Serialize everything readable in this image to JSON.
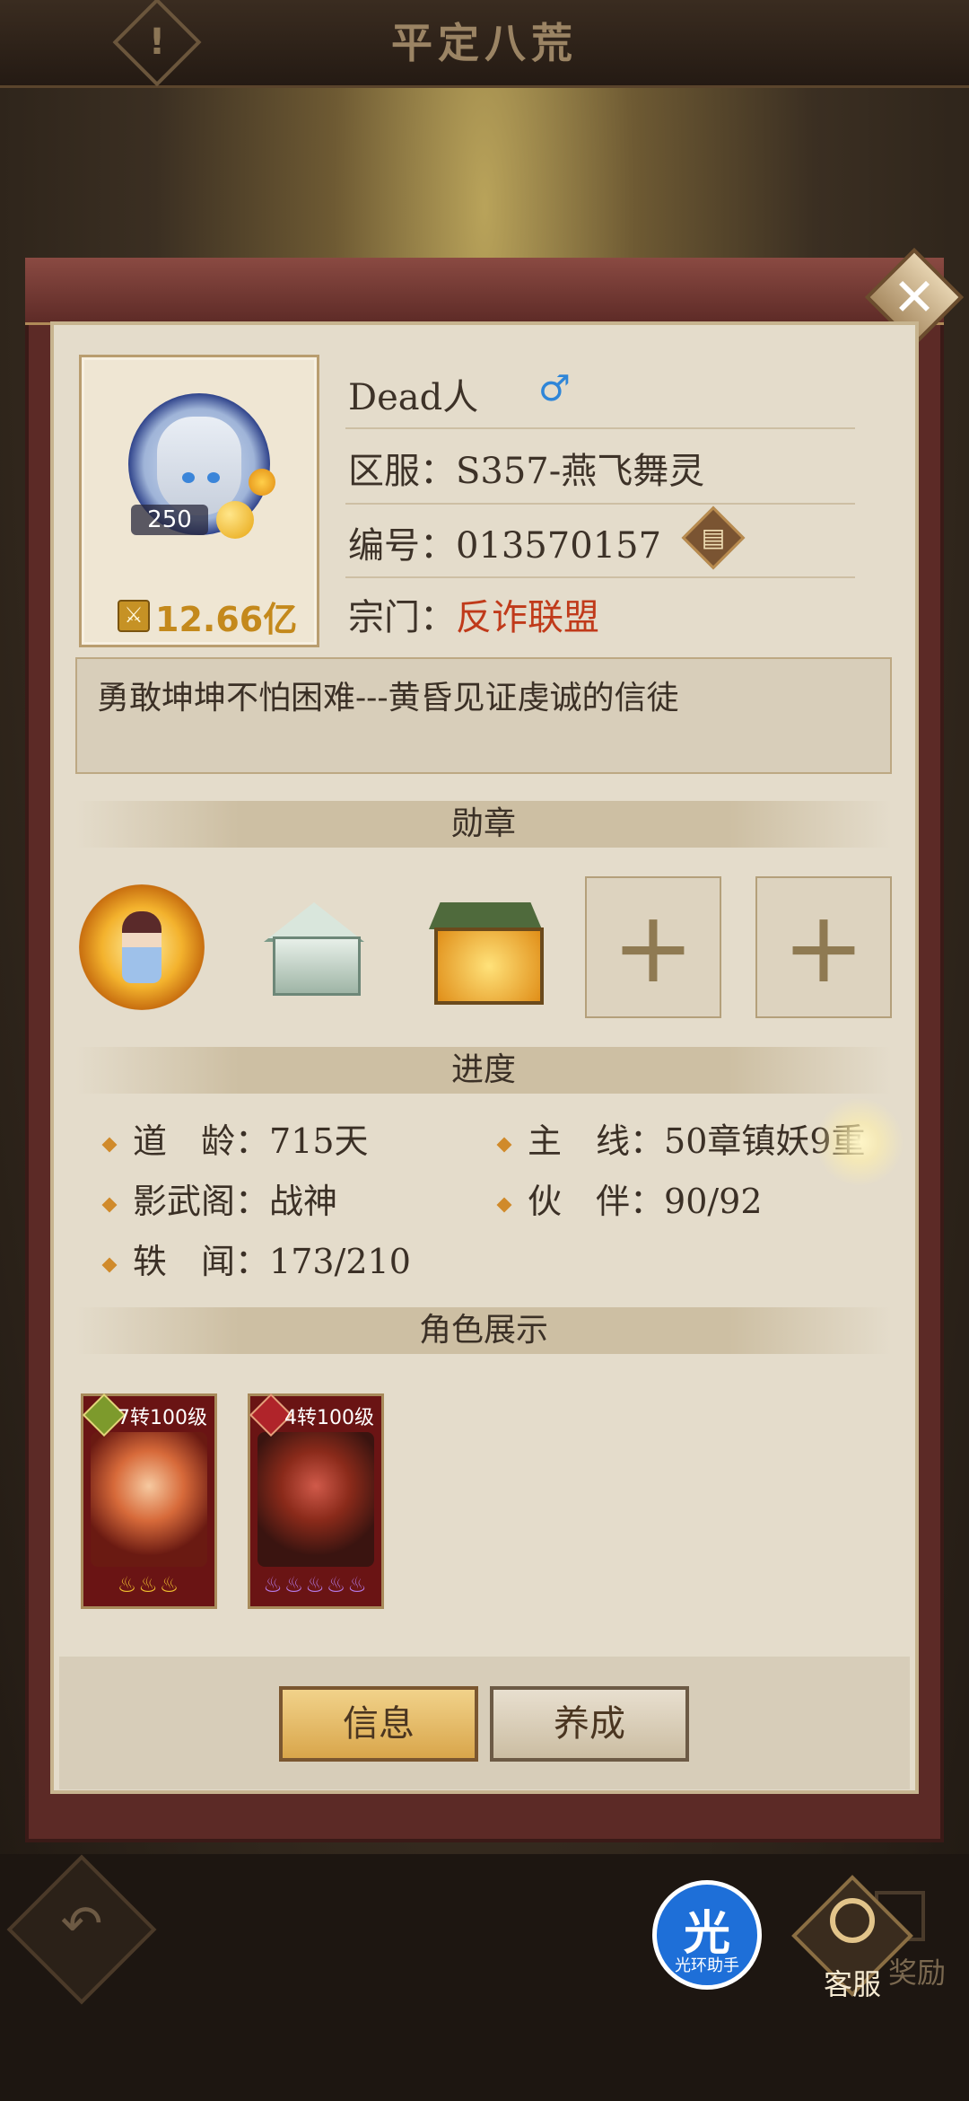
{
  "header": {
    "title": "平定八荒",
    "warn_glyph": "!"
  },
  "profile": {
    "name": "Dead人",
    "gender_symbol": "♂",
    "server_label": "区服：",
    "server_value": "S357-燕飞舞灵",
    "id_label": "编号：",
    "id_value": "013570157",
    "sect_label": "宗门：",
    "sect_value": "反诈联盟",
    "level": "250",
    "power": "12.66亿",
    "motto": "勇敢坤坤不怕困难---黄昏见证虔诚的信徒"
  },
  "sections": {
    "medals": "勋章",
    "progress": "进度",
    "characters": "角色展示"
  },
  "medals": {
    "empty_slot_glyph": "+"
  },
  "progress": {
    "items": [
      {
        "label": "道　龄：",
        "value": "715天"
      },
      {
        "label": "主　线：",
        "value": "50章镇妖9重"
      },
      {
        "label": "影武阁：",
        "value": "战神"
      },
      {
        "label": "伙　伴：",
        "value": "90/92"
      },
      {
        "label": "轶　闻：",
        "value": "173/210"
      }
    ]
  },
  "characters": [
    {
      "label": "7转100级",
      "stars": "♨♨♨",
      "stars_count": 3
    },
    {
      "label": "4转100级",
      "stars": "♨♨♨♨♨",
      "stars_count": 5
    }
  ],
  "buttons": {
    "info": "信息",
    "train": "养成"
  },
  "footer": {
    "helper_glyph": "光",
    "helper_label": "光环助手",
    "service": "客服",
    "reward": "奖励"
  },
  "colors": {
    "sect": "#c03a1a",
    "power": "#c4891c",
    "gender": "#2f86d8"
  }
}
